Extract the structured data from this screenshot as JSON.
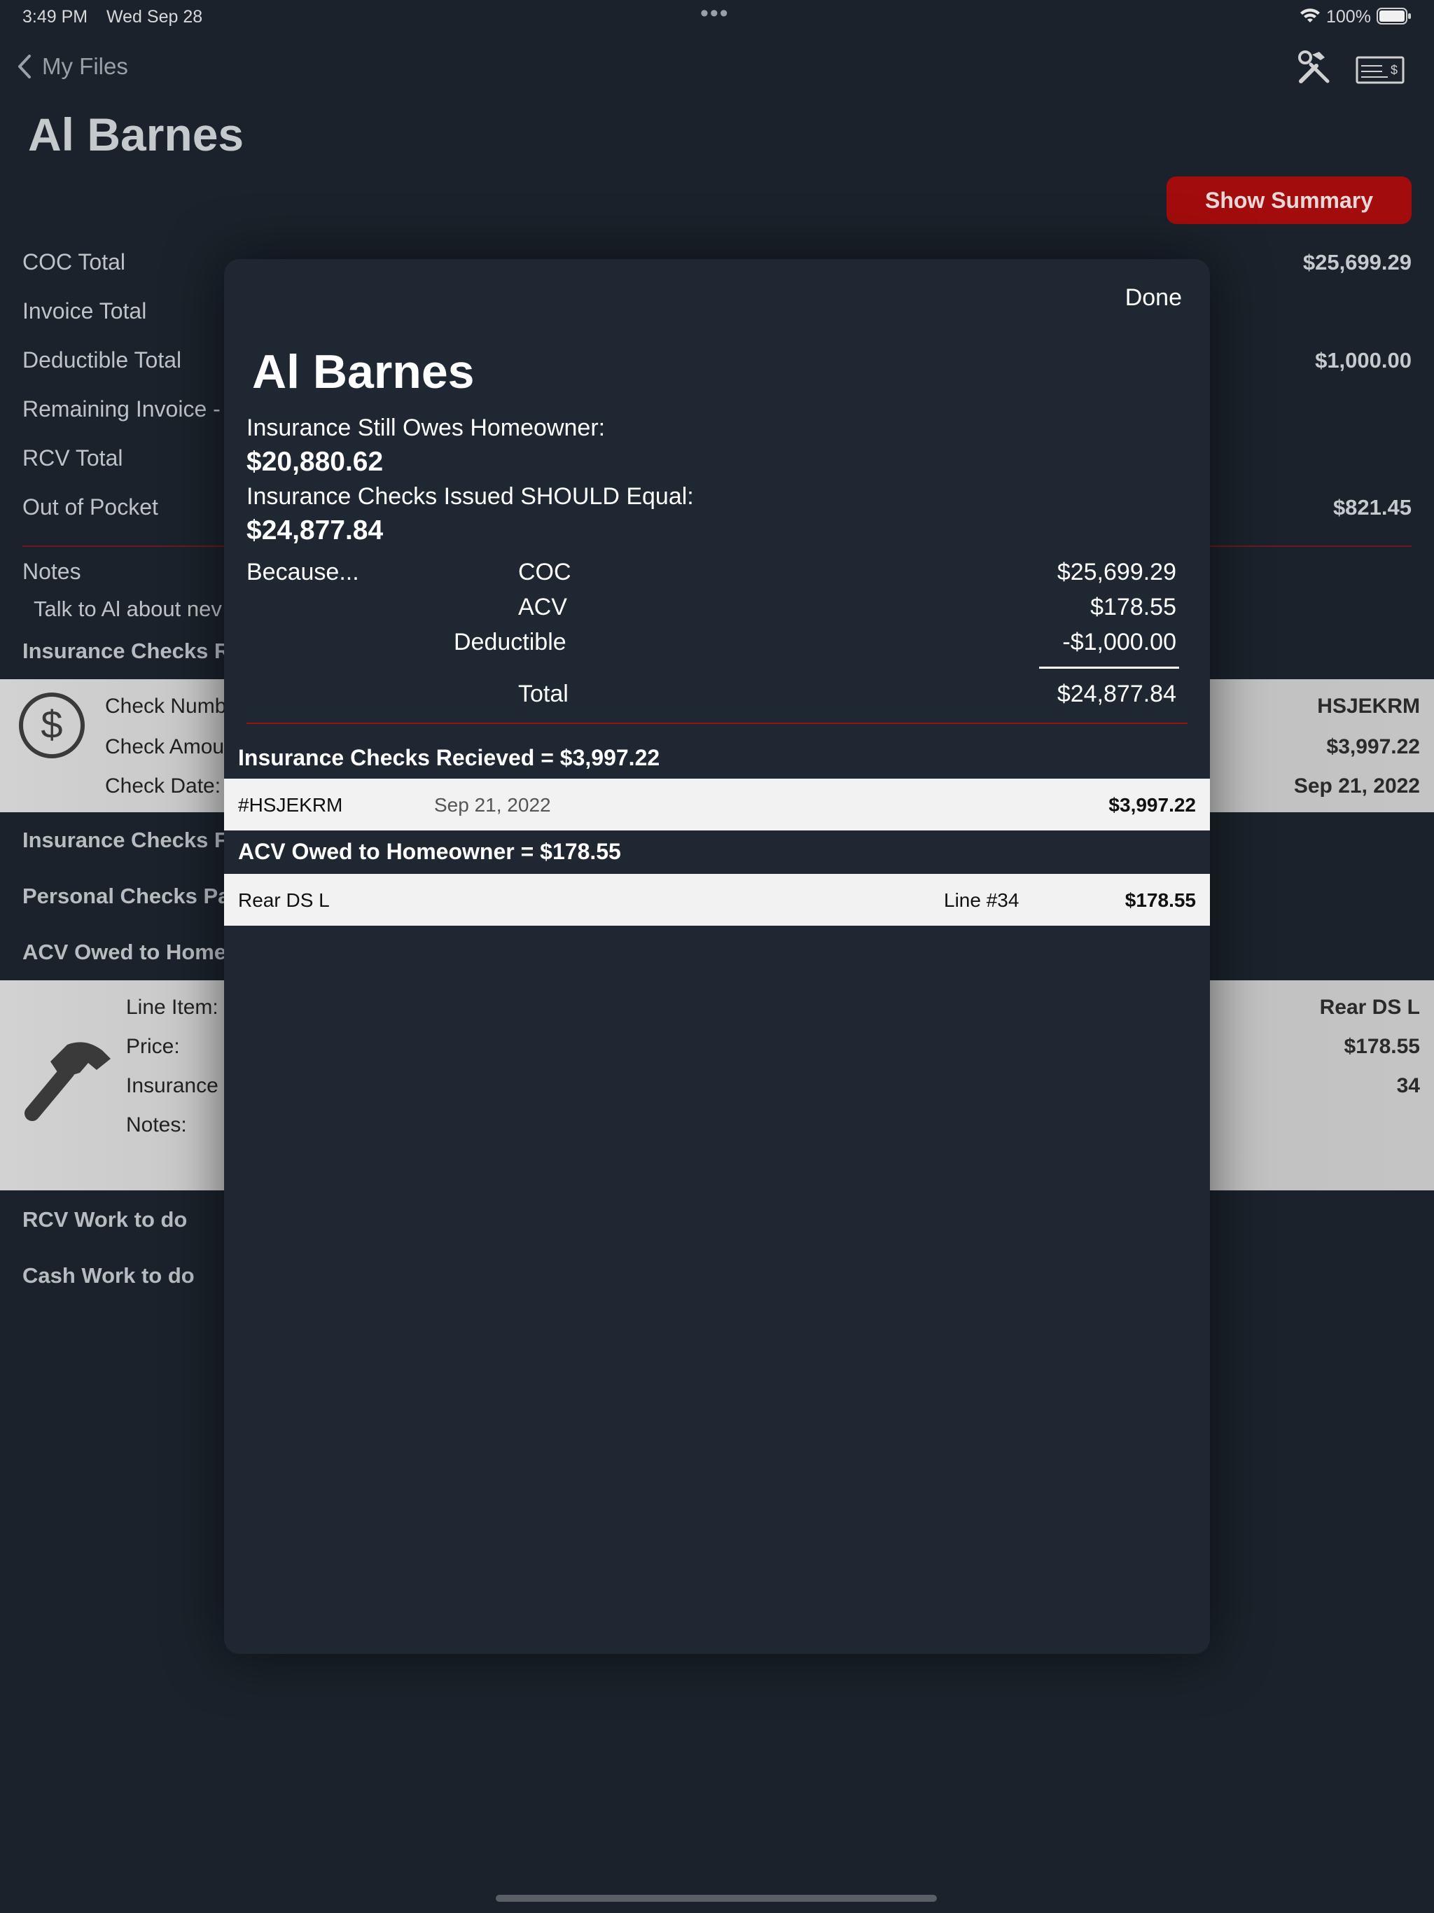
{
  "status_bar": {
    "time": "3:49 PM",
    "date": "Wed Sep 28",
    "dots": "•••",
    "battery": "100%"
  },
  "nav": {
    "back_label": "My Files",
    "title": "Al Barnes",
    "tools_icon": "hammer-wrench-icon",
    "check_icon": "check-icon"
  },
  "show_summary_label": "Show Summary",
  "totals": {
    "coc_label": "COC Total",
    "coc_value": "$25,699.29",
    "invoice_label": "Invoice Total",
    "deductible_label": "Deductible Total",
    "deductible_value": "$1,000.00",
    "remaining_label": "Remaining Invoice -",
    "rcv_label": "RCV Total",
    "oop_label": "Out of Pocket",
    "oop_value": "$821.45"
  },
  "notes": {
    "label": "Notes",
    "text": "Talk to Al about nev"
  },
  "sections": {
    "insurance_checks_r": "Insurance Checks R",
    "insurance_checks_f": "Insurance Checks F",
    "personal_checks": "Personal Checks Pa",
    "acv_owed": "ACV Owed to Home",
    "rcv_work": "RCV Work to do",
    "cash_work": "Cash Work to do"
  },
  "check_card": {
    "number_label": "Check Numb",
    "number_value": "HSJEKRM",
    "amount_label": "Check Amou",
    "amount_value": "$3,997.22",
    "date_label": "Check Date:",
    "date_value": "Sep 21, 2022"
  },
  "line_card": {
    "item_label": "Line Item:",
    "item_value": "Rear DS L",
    "price_label": "Price:",
    "price_value": "$178.55",
    "insurance_label": "Insurance",
    "insurance_value": "34",
    "notes_label": "Notes:"
  },
  "modal": {
    "done_label": "Done",
    "title": "Al Barnes",
    "owes_label": "Insurance Still Owes Homeowner:",
    "owes_value": "$20,880.62",
    "should_label": "Insurance Checks Issued SHOULD Equal:",
    "should_value": "$24,877.84",
    "because_label": "Because...",
    "calc": [
      {
        "label": "COC",
        "value": "$25,699.29"
      },
      {
        "label": "ACV",
        "value": "$178.55"
      },
      {
        "label": "Deductible",
        "value": "-$1,000.00"
      }
    ],
    "total_label": "Total",
    "total_value": "$24,877.84",
    "checks_received_header": "Insurance Checks Recieved = $3,997.22",
    "check_row": {
      "number": "#HSJEKRM",
      "date": "Sep 21, 2022",
      "amount": "$3,997.22"
    },
    "acv_header": "ACV Owed to Homeowner = $178.55",
    "acv_row": {
      "item": "Rear DS L",
      "line": "Line #34",
      "amount": "$178.55"
    }
  }
}
